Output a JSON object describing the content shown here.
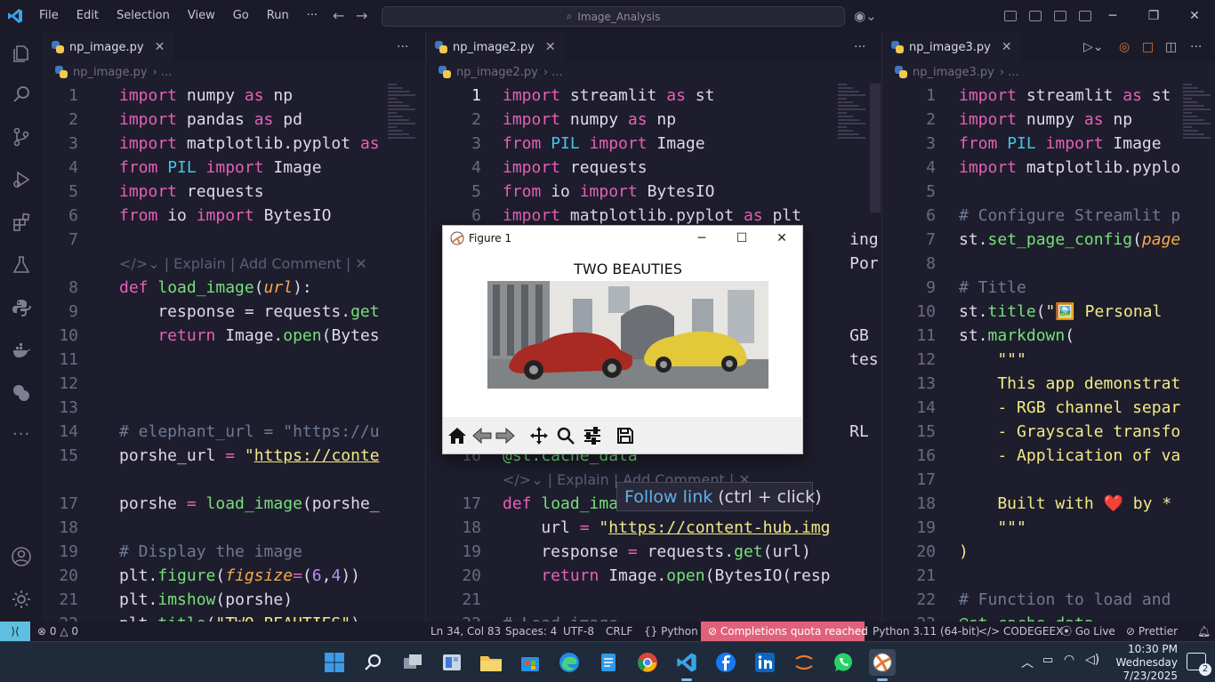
{
  "titlebar": {
    "menus": [
      "File",
      "Edit",
      "Selection",
      "View",
      "Go",
      "Run",
      "···"
    ],
    "search_text": "Image_Analysis"
  },
  "activity_icons": [
    "explorer-icon",
    "search-icon",
    "source-control-icon",
    "run-debug-icon",
    "extensions-icon",
    "testing-icon",
    "python-icon",
    "docker-icon",
    "python-env-icon",
    "more-icon",
    "account-icon",
    "settings-icon"
  ],
  "panes": [
    {
      "tab": "np_image.py",
      "breadcrumb": "np_image.py",
      "breadcrumb_tail": "...",
      "lines": [
        {
          "n": "1",
          "t": [
            [
              "kw",
              "import "
            ],
            [
              "",
              "numpy "
            ],
            [
              "kw",
              "as "
            ],
            [
              "",
              "np"
            ]
          ]
        },
        {
          "n": "2",
          "t": [
            [
              "kw",
              "import "
            ],
            [
              "",
              "pandas "
            ],
            [
              "kw",
              "as "
            ],
            [
              "",
              "pd"
            ]
          ]
        },
        {
          "n": "3",
          "t": [
            [
              "kw",
              "import "
            ],
            [
              "",
              "matplotlib.pyplot "
            ],
            [
              "kw",
              "as"
            ]
          ]
        },
        {
          "n": "4",
          "t": [
            [
              "kw",
              "from "
            ],
            [
              "mod",
              "PIL "
            ],
            [
              "kw",
              "import "
            ],
            [
              "",
              "Image"
            ]
          ]
        },
        {
          "n": "5",
          "t": [
            [
              "kw",
              "import "
            ],
            [
              "",
              "requests"
            ]
          ]
        },
        {
          "n": "6",
          "t": [
            [
              "kw",
              "from "
            ],
            [
              "",
              "io "
            ],
            [
              "kw",
              "import "
            ],
            [
              "",
              "BytesIO"
            ]
          ]
        },
        {
          "n": "7",
          "t": []
        },
        {
          "n": "",
          "t": [
            [
              "lens",
              "</>⌄ | Explain | Add Comment | ✕"
            ]
          ]
        },
        {
          "n": "8",
          "t": [
            [
              "kw",
              "def "
            ],
            [
              "fn",
              "load_image"
            ],
            [
              "",
              "("
            ],
            [
              "prm",
              "url"
            ],
            [
              "",
              "):"
            ]
          ]
        },
        {
          "n": "9",
          "t": [
            [
              "",
              "    response = requests."
            ],
            [
              "fn",
              "get"
            ]
          ]
        },
        {
          "n": "10",
          "t": [
            [
              "kw",
              "    return "
            ],
            [
              "",
              "Image."
            ],
            [
              "fn",
              "open"
            ],
            [
              "",
              "(Bytes"
            ]
          ]
        },
        {
          "n": "11",
          "t": []
        },
        {
          "n": "12",
          "t": []
        },
        {
          "n": "13",
          "t": []
        },
        {
          "n": "14",
          "t": [
            [
              "cmt",
              "# elephant_url = \"https://u"
            ]
          ]
        },
        {
          "n": "15",
          "t": [
            [
              "",
              "porshe_url "
            ],
            [
              "op",
              "= "
            ],
            [
              "str",
              "\""
            ],
            [
              "str lnk",
              "https://conte"
            ]
          ]
        },
        {
          "n": "",
          "t": []
        },
        {
          "n": "17",
          "t": [
            [
              "",
              "porshe "
            ],
            [
              "op",
              "= "
            ],
            [
              "fn",
              "load_image"
            ],
            [
              "",
              "(porshe_"
            ]
          ]
        },
        {
          "n": "18",
          "t": []
        },
        {
          "n": "19",
          "t": [
            [
              "cmt",
              "# Display the image"
            ]
          ]
        },
        {
          "n": "20",
          "t": [
            [
              "",
              "plt."
            ],
            [
              "fn",
              "figure"
            ],
            [
              "",
              "("
            ],
            [
              "prm",
              "figsize"
            ],
            [
              "op",
              "="
            ],
            [
              "",
              "("
            ],
            [
              "num",
              "6"
            ],
            [
              "",
              ","
            ],
            [
              "num",
              "4"
            ],
            [
              "",
              "))"
            ]
          ]
        },
        {
          "n": "21",
          "t": [
            [
              "",
              "plt."
            ],
            [
              "fn",
              "imshow"
            ],
            [
              "",
              "(porshe)"
            ]
          ]
        },
        {
          "n": "22",
          "t": [
            [
              "",
              "plt."
            ],
            [
              "fn",
              "title"
            ],
            [
              "",
              "("
            ],
            [
              "str",
              "\"TWO BEAUTIES\""
            ],
            [
              "",
              ")"
            ]
          ]
        }
      ]
    },
    {
      "tab": "np_image2.py",
      "breadcrumb": "np_image2.py",
      "breadcrumb_tail": "...",
      "lines": [
        {
          "n": "1",
          "cur": true,
          "t": [
            [
              "kw",
              "import "
            ],
            [
              "",
              "streamlit "
            ],
            [
              "kw",
              "as "
            ],
            [
              "",
              "st"
            ]
          ]
        },
        {
          "n": "2",
          "t": [
            [
              "kw",
              "import "
            ],
            [
              "",
              "numpy "
            ],
            [
              "kw",
              "as "
            ],
            [
              "",
              "np"
            ]
          ]
        },
        {
          "n": "3",
          "t": [
            [
              "kw",
              "from "
            ],
            [
              "mod",
              "PIL "
            ],
            [
              "kw",
              "import "
            ],
            [
              "",
              "Image"
            ]
          ]
        },
        {
          "n": "4",
          "t": [
            [
              "kw",
              "import "
            ],
            [
              "",
              "requests"
            ]
          ]
        },
        {
          "n": "5",
          "t": [
            [
              "kw",
              "from "
            ],
            [
              "",
              "io "
            ],
            [
              "kw",
              "import "
            ],
            [
              "",
              "BytesIO"
            ]
          ]
        },
        {
          "n": "6",
          "t": [
            [
              "kw",
              "import "
            ],
            [
              "",
              "matplotlib.pyplot "
            ],
            [
              "kw",
              "as "
            ],
            [
              "",
              "plt"
            ]
          ]
        },
        {
          "n": "",
          "t": [
            [
              "",
              "                                    ing"
            ]
          ]
        },
        {
          "n": "",
          "t": [
            [
              "",
              "                                    Por"
            ]
          ]
        },
        {
          "n": "",
          "t": []
        },
        {
          "n": "",
          "t": []
        },
        {
          "n": "",
          "t": [
            [
              "",
              "                                    GB ("
            ]
          ]
        },
        {
          "n": "",
          "t": [
            [
              "",
              "                                    tes"
            ]
          ]
        },
        {
          "n": "",
          "t": []
        },
        {
          "n": "",
          "t": []
        },
        {
          "n": "",
          "t": [
            [
              "",
              "                                    RL"
            ]
          ]
        },
        {
          "n": "16",
          "t": [
            [
              "fn",
              "@st.cache_data"
            ]
          ]
        },
        {
          "n": "",
          "t": [
            [
              "lens",
              "</>⌄ | Explain | Add Comment | ✕"
            ]
          ]
        },
        {
          "n": "17",
          "t": [
            [
              "kw",
              "def "
            ],
            [
              "fn",
              "load_ima"
            ]
          ]
        },
        {
          "n": "18",
          "t": [
            [
              "",
              "    url "
            ],
            [
              "op",
              "= "
            ],
            [
              "str",
              "\""
            ],
            [
              "str lnk",
              "https://content-hub.img"
            ]
          ]
        },
        {
          "n": "19",
          "t": [
            [
              "",
              "    response "
            ],
            [
              "op",
              "= "
            ],
            [
              "",
              "requests."
            ],
            [
              "fn",
              "get"
            ],
            [
              "",
              "(url)"
            ]
          ]
        },
        {
          "n": "20",
          "t": [
            [
              "kw",
              "    return "
            ],
            [
              "",
              "Image."
            ],
            [
              "fn",
              "open"
            ],
            [
              "",
              "(BytesIO(resp"
            ]
          ]
        },
        {
          "n": "21",
          "t": []
        },
        {
          "n": "22",
          "t": [
            [
              "cmt",
              "# Load image"
            ]
          ]
        }
      ]
    },
    {
      "tab": "np_image3.py",
      "breadcrumb": "np_image3.py",
      "breadcrumb_tail": "...",
      "lines": [
        {
          "n": "1",
          "t": [
            [
              "kw",
              "import "
            ],
            [
              "",
              "streamlit "
            ],
            [
              "kw",
              "as "
            ],
            [
              "",
              "st"
            ]
          ]
        },
        {
          "n": "2",
          "t": [
            [
              "kw",
              "import "
            ],
            [
              "",
              "numpy "
            ],
            [
              "kw",
              "as "
            ],
            [
              "",
              "np"
            ]
          ]
        },
        {
          "n": "3",
          "t": [
            [
              "kw",
              "from "
            ],
            [
              "mod",
              "PIL "
            ],
            [
              "kw",
              "import "
            ],
            [
              "",
              "Image"
            ]
          ]
        },
        {
          "n": "4",
          "t": [
            [
              "kw",
              "import "
            ],
            [
              "",
              "matplotlib.pyplo"
            ]
          ]
        },
        {
          "n": "5",
          "t": []
        },
        {
          "n": "6",
          "t": [
            [
              "cmt",
              "# Configure Streamlit p"
            ]
          ]
        },
        {
          "n": "7",
          "t": [
            [
              "",
              "st."
            ],
            [
              "fn",
              "set_page_config"
            ],
            [
              "",
              "("
            ],
            [
              "prm",
              "page"
            ]
          ]
        },
        {
          "n": "8",
          "t": []
        },
        {
          "n": "9",
          "t": [
            [
              "cmt",
              "# Title"
            ]
          ]
        },
        {
          "n": "10",
          "t": [
            [
              "",
              "st."
            ],
            [
              "fn",
              "title"
            ],
            [
              "",
              "("
            ],
            [
              "str",
              "\"🖼️ Personal"
            ]
          ]
        },
        {
          "n": "11",
          "t": [
            [
              "",
              "st."
            ],
            [
              "fn",
              "markdown"
            ],
            [
              "",
              "("
            ]
          ]
        },
        {
          "n": "12",
          "t": [
            [
              "str",
              "    \"\"\""
            ]
          ]
        },
        {
          "n": "13",
          "t": [
            [
              "str",
              "    This app demonstrat"
            ]
          ]
        },
        {
          "n": "14",
          "t": [
            [
              "str",
              "    - RGB channel separ"
            ]
          ]
        },
        {
          "n": "15",
          "t": [
            [
              "str",
              "    - Grayscale transfo"
            ]
          ]
        },
        {
          "n": "16",
          "t": [
            [
              "str",
              "    - Application of va"
            ]
          ]
        },
        {
          "n": "17",
          "t": []
        },
        {
          "n": "18",
          "t": [
            [
              "str",
              "    Built with ❤️ by *"
            ]
          ]
        },
        {
          "n": "19",
          "t": [
            [
              "str",
              "    \"\"\""
            ]
          ]
        },
        {
          "n": "20",
          "t": [
            [
              "str",
              ")"
            ]
          ]
        },
        {
          "n": "21",
          "t": []
        },
        {
          "n": "22",
          "t": [
            [
              "cmt",
              "# Function to load and"
            ]
          ]
        },
        {
          "n": "23",
          "t": [
            [
              "fn",
              "@st.cache_data"
            ]
          ]
        }
      ]
    }
  ],
  "figure": {
    "window_title": "Figure 1",
    "heading": "TWO BEAUTIES"
  },
  "tooltip": {
    "link": "Follow link",
    "hint": "(ctrl + click)"
  },
  "status": {
    "errors": "0",
    "warnings": "0",
    "position": "Ln 34, Col 83",
    "spaces": "Spaces: 4",
    "encoding": "UTF-8",
    "eol": "CRLF",
    "language": "Python",
    "warning_badge": "Completions quota reached",
    "interpreter": "Python 3.11 (64-bit)",
    "codegeex": "CODEGEEX",
    "golive": "Go Live",
    "prettier": "Prettier"
  },
  "taskbar": {
    "time": "10:30 PM",
    "day": "Wednesday",
    "date": "7/23/2025",
    "notifications": "2"
  }
}
